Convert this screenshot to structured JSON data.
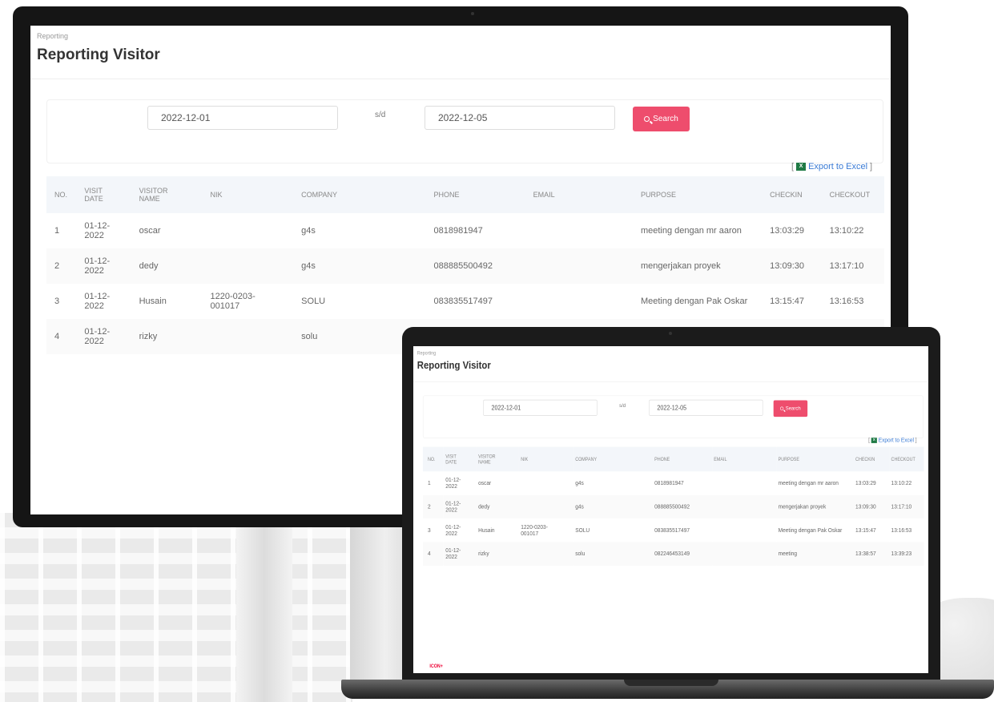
{
  "app": {
    "breadcrumb": "Reporting",
    "title": "Reporting Visitor"
  },
  "filter": {
    "date_from": "2022-12-01",
    "separator": "s/d",
    "date_to": "2022-12-05",
    "search_label": "Search"
  },
  "export": {
    "label": "Export to Excel",
    "icon": "excel-icon"
  },
  "table": {
    "headers": {
      "no": "NO.",
      "visit_date_1": "VISIT",
      "visit_date_2": "DATE",
      "visitor_name_1": "VISITOR",
      "visitor_name_2": "NAME",
      "nik": "NIK",
      "company": "COMPANY",
      "phone": "PHONE",
      "email": "EMAIL",
      "purpose": "PURPOSE",
      "checkin": "CHECKIN",
      "checkout": "CHECKOUT"
    },
    "rows": [
      {
        "no": "1",
        "date_a": "01-12-",
        "date_b": "2022",
        "name": "oscar",
        "nik_a": "",
        "nik_b": "",
        "company": "g4s",
        "phone": "0818981947",
        "email": "",
        "purpose": "meeting dengan mr aaron",
        "checkin": "13:03:29",
        "checkout": "13:10:22"
      },
      {
        "no": "2",
        "date_a": "01-12-",
        "date_b": "2022",
        "name": "dedy",
        "nik_a": "",
        "nik_b": "",
        "company": "g4s",
        "phone": "088885500492",
        "email": "",
        "purpose": "mengerjakan proyek",
        "checkin": "13:09:30",
        "checkout": "13:17:10"
      },
      {
        "no": "3",
        "date_a": "01-12-",
        "date_b": "2022",
        "name": "Husain",
        "nik_a": "1220-0203-",
        "nik_b": "001017",
        "company": "SOLU",
        "phone": "083835517497",
        "email": "",
        "purpose": "Meeting dengan Pak Oskar",
        "checkin": "13:15:47",
        "checkout": "13:16:53"
      },
      {
        "no": "4",
        "date_a": "01-12-",
        "date_b": "2022",
        "name": "rizky",
        "nik_a": "",
        "nik_b": "",
        "company": "solu",
        "phone": "082246453149",
        "email": "",
        "purpose": "meeting",
        "checkin": "13:38:57",
        "checkout": "13:39:23"
      }
    ]
  },
  "footer": {
    "logo_text": "ICON+"
  }
}
